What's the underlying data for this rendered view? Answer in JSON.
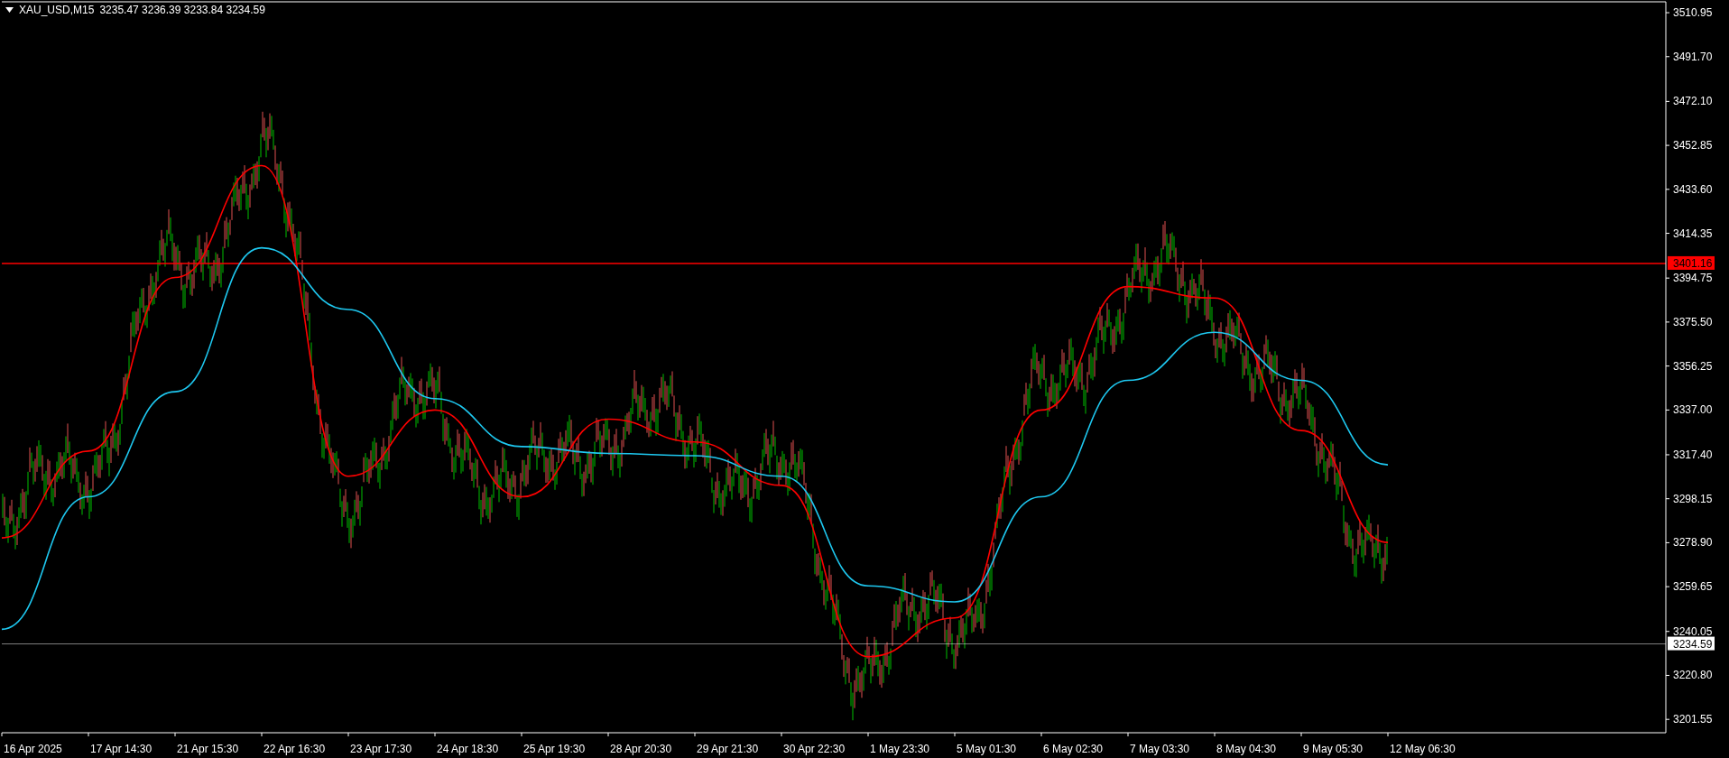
{
  "header": {
    "symbol": "XAU_USD,M15",
    "quotes": "3235.47 3236.39 3233.84 3234.59"
  },
  "chart": {
    "chart_data": {
      "type": "line",
      "categories": [
        "16 Apr 2025",
        "17 Apr 14:30",
        "21 Apr 15:30",
        "22 Apr 16:30",
        "23 Apr 17:30",
        "24 Apr 18:30",
        "25 Apr 19:30",
        "28 Apr 20:30",
        "29 Apr 21:30",
        "30 Apr 22:30",
        "1 May 23:30",
        "5 May 01:30",
        "6 May 02:30",
        "7 May 03:30",
        "8 May 04:30",
        "9 May 05:30",
        "12 May 06:30"
      ],
      "series": [
        {
          "color": "#ff0000",
          "values": [
            3281,
            3319,
            3395,
            3444,
            3308,
            3337,
            3299,
            3333,
            3323,
            3304,
            3229,
            3246,
            3337,
            3391,
            3386,
            3328,
            3279
          ]
        },
        {
          "color": "#1ec8f0",
          "values": [
            3241,
            3299,
            3345,
            3408,
            3381,
            3342,
            3321,
            3318,
            3317,
            3308,
            3260,
            3253,
            3299,
            3350,
            3371,
            3350,
            3313
          ]
        }
      ],
      "ylim": [
        3195.7,
        3516.5
      ],
      "yticks": [
        {
          "value": 3510.95,
          "label": "3510.95"
        },
        {
          "value": 3491.7,
          "label": "3491.70"
        },
        {
          "value": 3472.1,
          "label": "3472.10"
        },
        {
          "value": 3452.85,
          "label": "3452.85"
        },
        {
          "value": 3433.6,
          "label": "3433.60"
        },
        {
          "value": 3414.35,
          "label": "3414.35"
        },
        {
          "value": 3394.75,
          "label": "3394.75"
        },
        {
          "value": 3375.5,
          "label": "3375.50"
        },
        {
          "value": 3356.25,
          "label": "3356.25"
        },
        {
          "value": 3337,
          "label": "3337.00"
        },
        {
          "value": 3317.4,
          "label": "3317.40"
        },
        {
          "value": 3298.15,
          "label": "3298.15"
        },
        {
          "value": 3278.9,
          "label": "3278.90"
        },
        {
          "value": 3259.65,
          "label": "3259.65"
        },
        {
          "value": 3240.05,
          "label": "3240.05"
        },
        {
          "value": 3220.8,
          "label": "3220.80"
        },
        {
          "value": 3201.55,
          "label": "3201.55"
        }
      ]
    },
    "price_lines": [
      {
        "kind": "level",
        "label": "3401.16",
        "color": "#ff0000"
      },
      {
        "kind": "bid",
        "label": "3234.59",
        "color": "#ffffff"
      }
    ]
  }
}
